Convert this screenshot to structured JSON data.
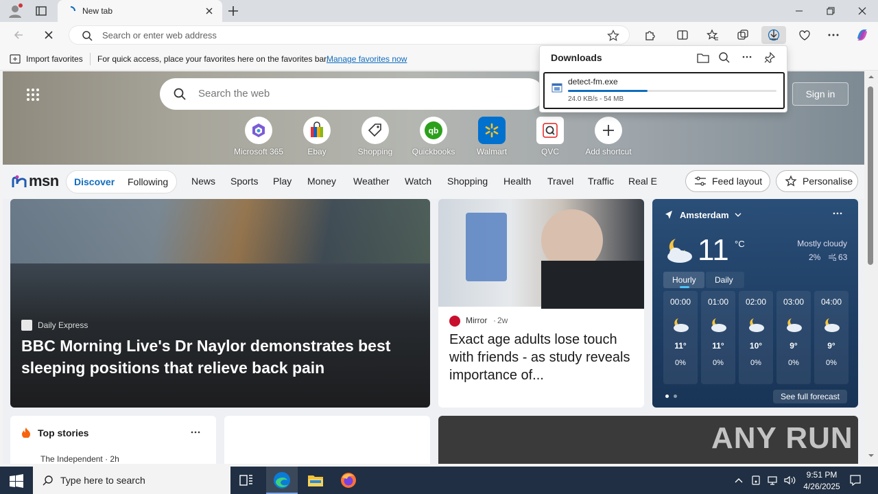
{
  "browser": {
    "tab_title": "New tab",
    "address_placeholder": "Search or enter web address"
  },
  "favorites_bar": {
    "import_label": "Import favorites",
    "hint": "For quick access, place your favorites here on the favorites bar.",
    "manage_link": "Manage favorites now"
  },
  "downloads": {
    "title": "Downloads",
    "file_name": "detect-fm.exe",
    "status": "24.0 KB/s - 54 MB",
    "progress": 0.38
  },
  "newtab": {
    "search_placeholder": "Search the web",
    "signin_label": "Sign in",
    "shortcuts": [
      {
        "label": "Microsoft 365",
        "icon": "microsoft-365-icon"
      },
      {
        "label": "Ebay",
        "icon": "ebay-bag-icon"
      },
      {
        "label": "Shopping",
        "icon": "price-tag-icon"
      },
      {
        "label": "Quickbooks",
        "icon": "quickbooks-icon"
      },
      {
        "label": "Walmart",
        "icon": "walmart-spark-icon"
      },
      {
        "label": "QVC",
        "icon": "qvc-icon"
      },
      {
        "label": "Add shortcut",
        "icon": "plus-icon"
      }
    ]
  },
  "nav": {
    "logo": "msn",
    "discover": "Discover",
    "following": "Following",
    "items": [
      "News",
      "Sports",
      "Play",
      "Money",
      "Weather",
      "Watch",
      "Shopping",
      "Health",
      "Travel",
      "Traffic",
      "Real E"
    ],
    "feed_layout": "Feed layout",
    "personalise": "Personalise"
  },
  "hero_story": {
    "source": "Daily Express",
    "headline": "BBC Morning Live's Dr Naylor demonstrates best sleeping positions that relieve back pain"
  },
  "second_story": {
    "source": "Mirror",
    "age": "2w",
    "headline": "Exact age adults lose touch with friends - as study reveals importance of..."
  },
  "weather": {
    "location": "Amsterdam",
    "temp": "11",
    "unit": "°C",
    "condition": "Mostly cloudy",
    "precip": "2%",
    "aqi": "63",
    "tab_hourly": "Hourly",
    "tab_daily": "Daily",
    "hours": [
      {
        "time": "00:00",
        "temp": "11°",
        "precip": "0%"
      },
      {
        "time": "01:00",
        "temp": "11°",
        "precip": "0%"
      },
      {
        "time": "02:00",
        "temp": "10°",
        "precip": "0%"
      },
      {
        "time": "03:00",
        "temp": "9°",
        "precip": "0%"
      },
      {
        "time": "04:00",
        "temp": "9°",
        "precip": "0%"
      }
    ],
    "full_forecast": "See full forecast"
  },
  "top_stories": {
    "title": "Top stories",
    "first_source": "The Independent · 2h"
  },
  "watermark": "ANY RUN",
  "taskbar": {
    "search_placeholder": "Type here to search",
    "time": "9:51 PM",
    "date": "4/26/2025"
  },
  "colors": {
    "accent": "#0f6cbd",
    "msn_blue": "#1f5bb0",
    "taskbar": "#202f43"
  }
}
